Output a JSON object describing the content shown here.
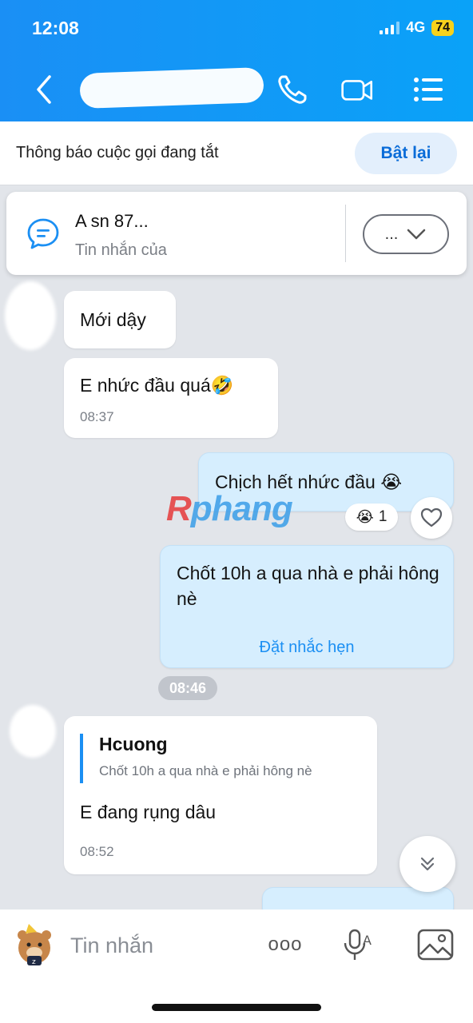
{
  "status_bar": {
    "time": "12:08",
    "network": "4G",
    "battery": "74"
  },
  "header": {
    "contact_name": ""
  },
  "banner": {
    "text": "Thông báo cuộc gọi đang tắt",
    "button": "Bật lại"
  },
  "pinned": {
    "title": "A sn 87...",
    "subtitle": "Tin nhắn của",
    "more": "...",
    "chevron": "⌄"
  },
  "messages": [
    {
      "side": "in",
      "text": "Mới dậy"
    },
    {
      "side": "in",
      "text": "E nhức đầu quá🤣",
      "time": "08:37"
    },
    {
      "side": "out",
      "text": "Chịch hết nhức đầu 😭"
    },
    {
      "side": "out",
      "text": "Chốt 10h a qua nhà e phải hông nè",
      "action": "Đặt nhắc hẹn"
    },
    {
      "side": "in",
      "quote_name": "Hcuong",
      "quote_text": "Chốt 10h a qua nhà e phải hông nè",
      "text": "E đang rụng dâu",
      "time": "08:52"
    }
  ],
  "reaction": {
    "emoji": "😭",
    "count": "1"
  },
  "time_divider": "08:46",
  "watermark": {
    "first": "R",
    "rest": "phang"
  },
  "input": {
    "placeholder": "Tin nhắn",
    "more": "ooo"
  },
  "colors": {
    "header": "#1a8ff5",
    "outgoing": "#d6eefe",
    "link": "#1b8ff3",
    "battery": "#f8d21c"
  }
}
